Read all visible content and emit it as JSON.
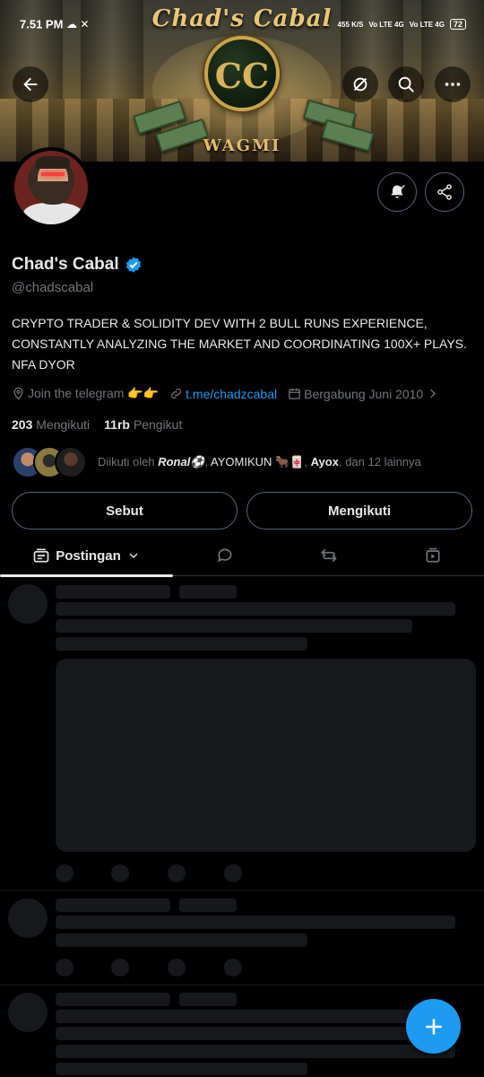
{
  "status_bar": {
    "time": "7.51 PM",
    "speed": "455 K/S",
    "network_1": "Vo LTE 4G",
    "network_2": "Vo LTE 4G",
    "battery": "72"
  },
  "banner": {
    "title": "Chad's Cabal",
    "coin_letters": "CC",
    "subtitle": "WAGMI"
  },
  "profile": {
    "name": "Chad's Cabal",
    "handle": "@chadscabal",
    "bio": "CRYPTO TRADER & SOLIDITY DEV WITH 2 BULL RUNS EXPERIENCE, CONSTANTLY ANALYZING THE MARKET AND COORDINATING 100X+ PLAYS. NFA DYOR",
    "location": "Join the telegram 👉👉",
    "website": "t.me/chadzcabal",
    "joined": "Bergabung Juni 2010"
  },
  "counts": {
    "following_value": "203",
    "following_label": "Mengikuti",
    "followers_value": "11rb",
    "followers_label": "Pengikut"
  },
  "followed_by": {
    "prefix": "Diikuti oleh",
    "name1": "Ronal⚽",
    "name2": "AYOMIKUN 🐂🀄",
    "name3": "Ayox",
    "suffix": ", dan 12 lainnya"
  },
  "buttons": {
    "mention": "Sebut",
    "following": "Mengikuti"
  },
  "tabs": {
    "posts_label": "Postingan"
  },
  "colors": {
    "accent": "#1d9bf0",
    "background": "#000000",
    "muted_text": "#71767b",
    "skeleton": "#16181c"
  },
  "icons": {
    "back": "arrow-left-icon",
    "grok": "grok-icon",
    "search": "search-icon",
    "more": "more-icon",
    "notify": "bell-check-icon",
    "share": "share-icon",
    "verified": "verified-badge-icon",
    "location": "location-pin-icon",
    "link": "link-icon",
    "calendar": "calendar-icon",
    "compose": "plus-icon"
  }
}
